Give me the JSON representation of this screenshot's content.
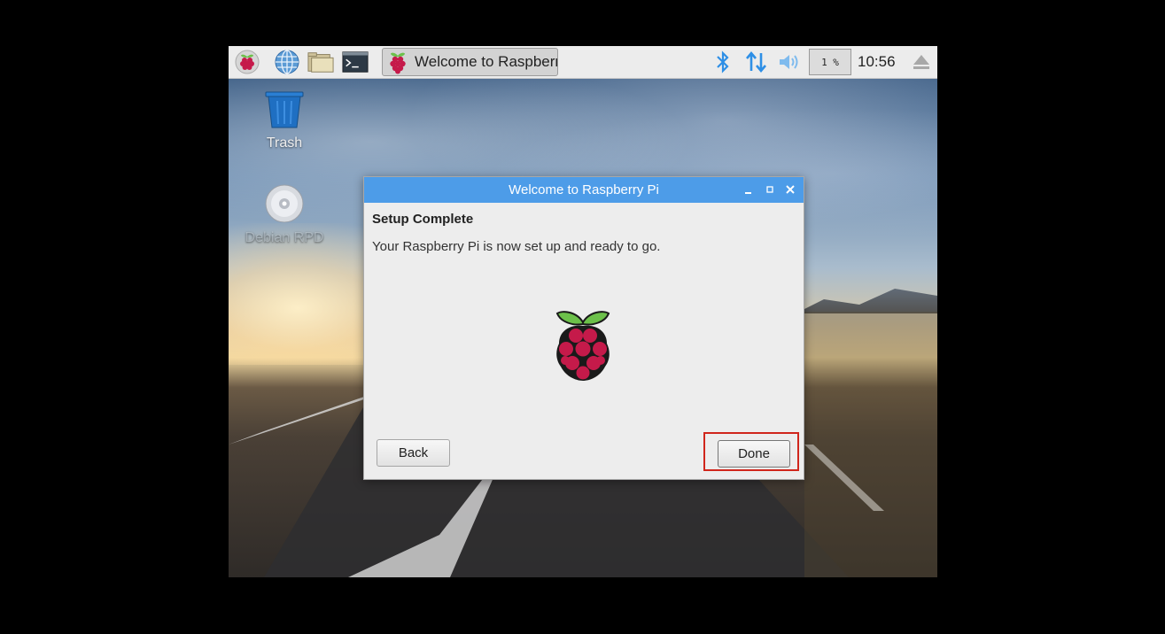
{
  "taskbar": {
    "task_title": "Welcome to Raspberr…",
    "cpu_usage": "1 %",
    "clock": "10:56"
  },
  "desktop": {
    "icons": [
      {
        "label": "Trash"
      },
      {
        "label": "Debian RPD"
      }
    ]
  },
  "dialog": {
    "title": "Welcome to Raspberry Pi",
    "heading": "Setup Complete",
    "message": "Your Raspberry Pi is now set up and ready to go.",
    "back_label": "Back",
    "done_label": "Done"
  },
  "icons": {
    "menu": "raspberry-icon",
    "browser": "globe-icon",
    "files": "folder-icon",
    "terminal": "terminal-icon",
    "bluetooth": "bluetooth-icon",
    "network": "network-arrows-icon",
    "volume": "volume-icon",
    "eject": "eject-icon"
  },
  "colors": {
    "titlebar": "#4d9ce8",
    "highlight": "#d0261c",
    "raspberry": "#c51a4a",
    "leaf": "#6cc04a"
  }
}
